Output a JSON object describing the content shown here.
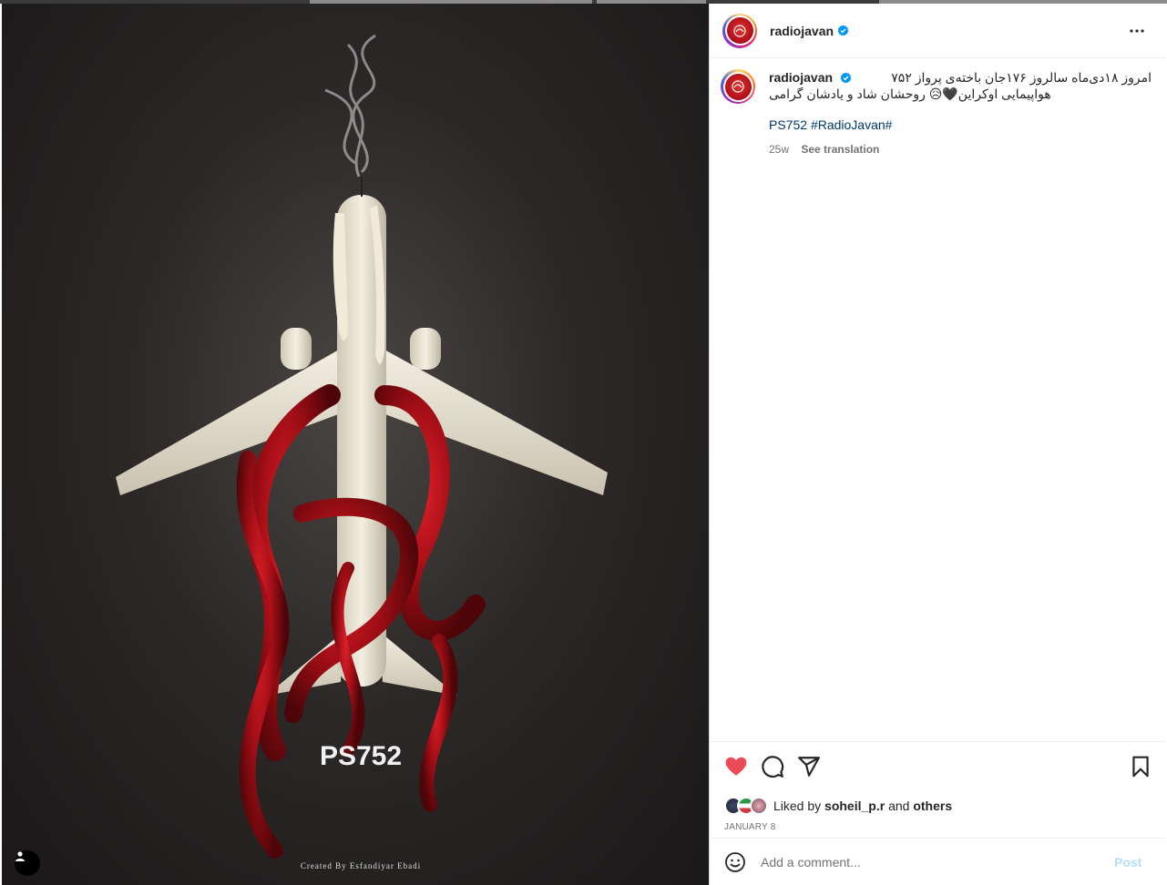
{
  "post": {
    "author": "radiojavan",
    "verified_icon": "verified-badge-icon",
    "more_icon": "more-options-icon",
    "image": {
      "overlay_text": "PS752",
      "credit": "Created By Esfandiyar Ebadi",
      "user_tag_icon": "user-tag-icon"
    }
  },
  "caption": {
    "username": "radiojavan",
    "line1": "امروز ۱۸دی‌ماه سالروز ۱۷۶جان باخته‌ی پرواز ۷۵۲",
    "line2": "هواپیمایی اوکراین🖤😥 روحشان شاد و یادشان گرامی",
    "hashtags": [
      "PS752",
      "#RadioJavan#"
    ],
    "age": "25w",
    "see_translation": "See translation"
  },
  "actions": {
    "like_icon": "heart-filled-icon",
    "comment_icon": "comment-icon",
    "share_icon": "share-icon",
    "save_icon": "bookmark-icon"
  },
  "likes": {
    "prefix": "Liked by",
    "user": "soheil_p.r",
    "connector": "and",
    "others": "others"
  },
  "date": "JANUARY 8",
  "comment": {
    "placeholder": "Add a comment...",
    "post_label": "Post",
    "emoji_icon": "emoji-icon"
  },
  "colors": {
    "like_red": "#ed4956",
    "link_blue": "#00376b",
    "verified_blue": "#0095f6",
    "post_disabled": "#b2dffc"
  }
}
